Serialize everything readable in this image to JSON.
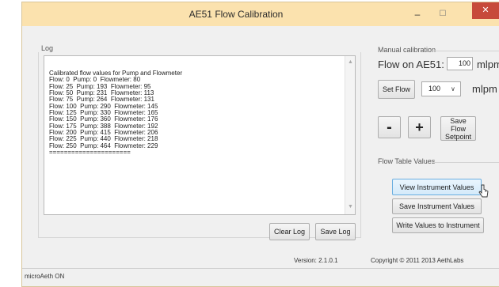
{
  "window": {
    "title": "AE51 Flow Calibration",
    "minimize": "–",
    "maximize": "☐",
    "close": "✕"
  },
  "log": {
    "group_label": "Log",
    "lines": [
      "Calibrated flow values for Pump and Flowmeter",
      "Flow: 0  Pump: 0  Flowmeter: 80",
      "Flow: 25  Pump: 193  Flowmeter: 95",
      "Flow: 50  Pump: 231  Flowmeter: 113",
      "Flow: 75  Pump: 264  Flowmeter: 131",
      "Flow: 100  Pump: 290  Flowmeter: 145",
      "Flow: 125  Pump: 330  Flowmeter: 165",
      "Flow: 150  Pump: 360  Flowmeter: 176",
      "Flow: 175  Pump: 388  Flowmeter: 192",
      "Flow: 200  Pump: 415  Flowmeter: 206",
      "Flow: 225  Pump: 440  Flowmeter: 218",
      "Flow: 250  Pump: 464  Flowmeter: 229",
      "======================"
    ],
    "clear_label": "Clear Log",
    "save_label": "Save Log"
  },
  "manual": {
    "group_label": "Manual calibration",
    "flow_label": "Flow on AE51:",
    "flow_value": "100",
    "unit1": "mlpm",
    "set_flow_label": "Set Flow",
    "select_value": "100",
    "unit2": "mlpm",
    "minus_label": "-",
    "plus_label": "+",
    "save_setpoint_label": "Save Flow Setpoint"
  },
  "flow_table": {
    "group_label": "Flow Table Values",
    "view_label": "View Instrument Values",
    "save_label": "Save Instrument Values",
    "write_label": "Write Values to Instrument"
  },
  "footer": {
    "version": "Version: 2.1.0.1",
    "copyright": "Copyright © 2011 2013 AethLabs"
  },
  "status": {
    "text": "microAeth ON"
  }
}
